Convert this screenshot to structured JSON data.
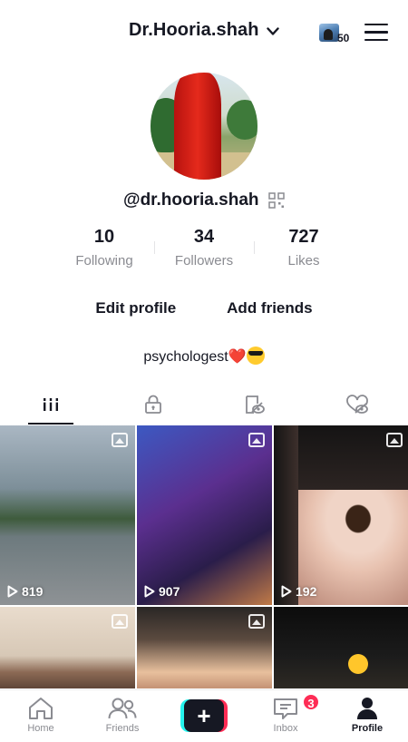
{
  "header": {
    "username": "Dr.Hooria.shah",
    "creator_badge_count": "50"
  },
  "profile": {
    "handle": "@dr.hooria.shah",
    "stats": [
      {
        "value": "10",
        "label": "Following"
      },
      {
        "value": "34",
        "label": "Followers"
      },
      {
        "value": "727",
        "label": "Likes"
      }
    ],
    "edit_profile_label": "Edit profile",
    "add_friends_label": "Add friends",
    "bio_text": "psychologest",
    "bio_heart": "❤️"
  },
  "tabs": [
    {
      "name": "videos",
      "icon": "grid-icon",
      "active": true
    },
    {
      "name": "private",
      "icon": "lock-icon",
      "active": false
    },
    {
      "name": "reposts",
      "icon": "repost-icon",
      "active": false
    },
    {
      "name": "liked",
      "icon": "hidden-heart-icon",
      "active": false
    }
  ],
  "videos": [
    {
      "views": "819"
    },
    {
      "views": "907"
    },
    {
      "views": "192"
    },
    {
      "views": ""
    },
    {
      "views": ""
    },
    {
      "views": ""
    }
  ],
  "bottom_nav": {
    "home": "Home",
    "friends": "Friends",
    "inbox": "Inbox",
    "inbox_badge": "3",
    "profile": "Profile"
  },
  "colors": {
    "accent_red": "#fe2c55",
    "accent_cyan": "#25f4ee",
    "text_primary": "#161823",
    "text_secondary": "#8a8b91"
  }
}
